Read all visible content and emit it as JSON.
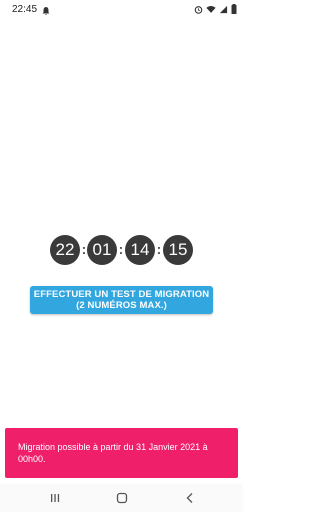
{
  "status_bar": {
    "time": "22:45",
    "left_icon": "notification-icon",
    "right_icons": [
      "alarm-icon",
      "wifi-icon",
      "signal-icon",
      "battery-icon"
    ]
  },
  "countdown": {
    "hours": "22",
    "minutes": "01",
    "seconds": "14",
    "frames": "15",
    "separator": ":"
  },
  "migration_button": {
    "label": "EFFECTUER UN TEST DE MIGRATION (2 NUMÉROS MAX.)"
  },
  "snackbar": {
    "message": "Migration possible à partir du 31 Janvier 2021 à 00h00."
  },
  "nav_bar": {
    "icons": [
      "recent-apps-icon",
      "home-icon",
      "back-icon"
    ]
  },
  "colors": {
    "button": "#31a6df",
    "snackbar": "#ef1f6a",
    "digit_bg": "#3a3a3a"
  }
}
